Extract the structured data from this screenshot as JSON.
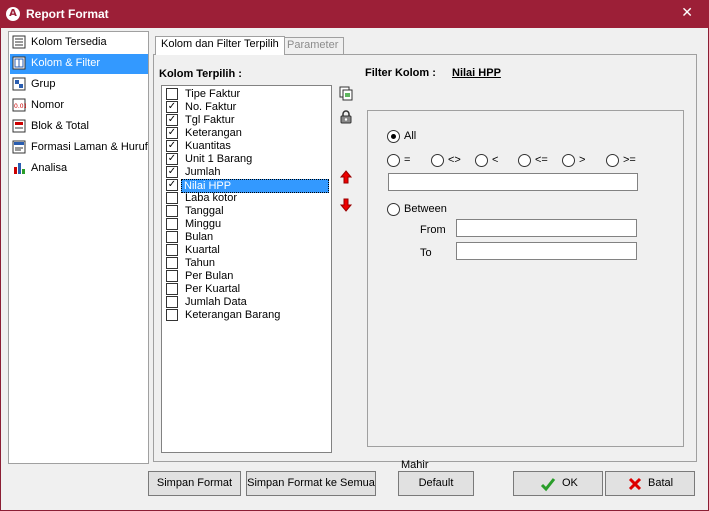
{
  "window": {
    "title": "Report Format"
  },
  "nav": {
    "items": [
      {
        "label": "Kolom Tersedia",
        "icon": "columns-icon"
      },
      {
        "label": "Kolom & Filter",
        "icon": "filter-icon",
        "selected": true
      },
      {
        "label": "Grup",
        "icon": "group-icon"
      },
      {
        "label": "Nomor",
        "icon": "number-icon"
      },
      {
        "label": "Blok & Total",
        "icon": "block-total-icon"
      },
      {
        "label": "Formasi Laman & Huruf",
        "icon": "page-format-icon"
      },
      {
        "label": "Analisa",
        "icon": "chart-icon"
      }
    ]
  },
  "tabs": [
    {
      "label": "Kolom dan Filter Terpilih",
      "active": true
    },
    {
      "label": "Parameter",
      "active": false
    }
  ],
  "columns": {
    "header": "Kolom Terpilih :",
    "items": [
      {
        "label": "Tipe Faktur",
        "checked": false
      },
      {
        "label": "No. Faktur",
        "checked": true
      },
      {
        "label": "Tgl Faktur",
        "checked": true
      },
      {
        "label": "Keterangan",
        "checked": true
      },
      {
        "label": "Kuantitas",
        "checked": true
      },
      {
        "label": "Unit 1 Barang",
        "checked": true
      },
      {
        "label": "Jumlah",
        "checked": true
      },
      {
        "label": "Nilai HPP",
        "checked": true,
        "selected": true
      },
      {
        "label": "Laba kotor",
        "checked": false
      },
      {
        "label": "Tanggal",
        "checked": false
      },
      {
        "label": "Minggu",
        "checked": false
      },
      {
        "label": "Bulan",
        "checked": false
      },
      {
        "label": "Kuartal",
        "checked": false
      },
      {
        "label": "Tahun",
        "checked": false
      },
      {
        "label": "Per Bulan",
        "checked": false
      },
      {
        "label": "Per Kuartal",
        "checked": false
      },
      {
        "label": "Jumlah Data",
        "checked": false
      },
      {
        "label": "Keterangan Barang",
        "checked": false
      }
    ]
  },
  "filter": {
    "header": "Filter Kolom :",
    "column_name": "Nilai HPP",
    "all_label": "All",
    "operators": [
      "=",
      "<>",
      "<",
      "<=",
      ">",
      ">="
    ],
    "value": "",
    "between_label": "Between",
    "from_label": "From",
    "to_label": "To",
    "from_value": "",
    "to_value": ""
  },
  "status_text": "Mahir",
  "buttons": {
    "save_format": "Simpan Format",
    "save_format_all": "Simpan Format ke Semua",
    "default": "Default",
    "ok": "OK",
    "cancel": "Batal"
  }
}
